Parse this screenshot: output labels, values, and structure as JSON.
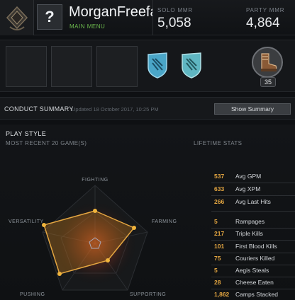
{
  "header": {
    "player_name": "MorganFreefa",
    "menu_label": "MAIN MENU",
    "avatar_glyph": "?",
    "solo_mmr_label": "SOLO MMR",
    "solo_mmr_value": "5,058",
    "party_mmr_label": "PARTY MMR",
    "party_mmr_value": "4,864"
  },
  "heroes": {
    "slots": [
      "",
      "",
      ""
    ],
    "shields": [
      "shield-icon",
      "shield-icon"
    ],
    "level": "35"
  },
  "conduct": {
    "title": "CONDUCT SUMMARY",
    "updated": "Updated 18 October 2017, 10:25 PM",
    "show_summary_label": "Show Summary"
  },
  "playstyle": {
    "title": "PLAY STYLE",
    "recent_label": "MOST RECENT 20 GAME(S)",
    "lifetime_label": "LIFETIME STATS",
    "radar_axes": [
      "FIGHTING",
      "FARMING",
      "SUPPORTING",
      "PUSHING",
      "VERSATILITY"
    ]
  },
  "lifetime_stats": {
    "group1": [
      {
        "value": "537",
        "name": "Avg GPM"
      },
      {
        "value": "633",
        "name": "Avg XPM"
      },
      {
        "value": "266",
        "name": "Avg Last Hits"
      }
    ],
    "group2": [
      {
        "value": "5",
        "name": "Rampages"
      },
      {
        "value": "217",
        "name": "Triple Kills"
      },
      {
        "value": "101",
        "name": "First Blood Kills"
      },
      {
        "value": "75",
        "name": "Couriers Killed"
      },
      {
        "value": "5",
        "name": "Aegis Steals"
      },
      {
        "value": "28",
        "name": "Cheese Eaten"
      },
      {
        "value": "1,862",
        "name": "Camps Stacked"
      }
    ]
  },
  "colors": {
    "accent_orange": "#e4a641",
    "menu_green": "#6dbb4e",
    "shield_blue": "#4aa6c8",
    "radar_fill": "#c77a1e"
  }
}
